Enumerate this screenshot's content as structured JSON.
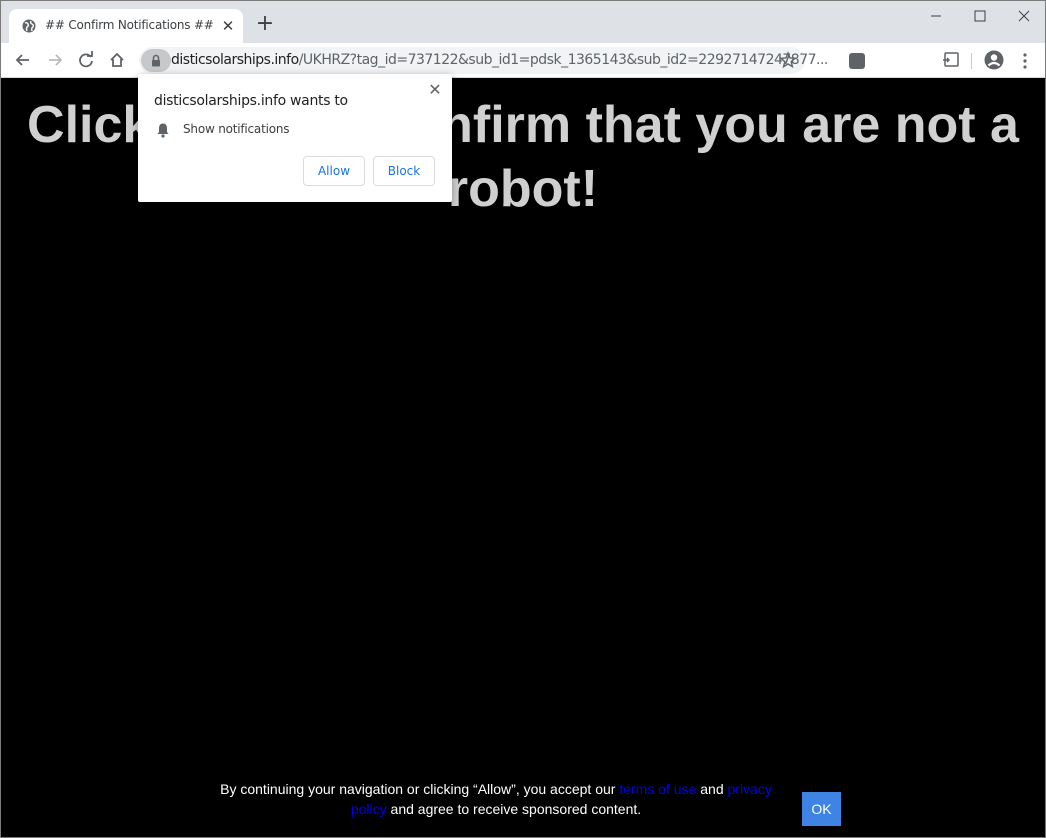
{
  "browser": {
    "tab_title": "## Confirm Notifications ##",
    "tab_close": "✕",
    "new_tab": "+",
    "url_domain": "disticsolarships.info",
    "url_path": "/UKHRZ?tag_id=737122&sub_id1=pdsk_1365143&sub_id2=22927147247877..."
  },
  "page": {
    "headline": "Click Allow to confirm that you are not a robot!",
    "footer": {
      "text_before": "By continuing your navigation or clicking “Allow”, you accept our ",
      "terms_link": "terms of use",
      "text_and": " and ",
      "privacy_link": "privacy policy",
      "text_after": " and agree to receive sponsored content."
    },
    "ok_button": "OK"
  },
  "popup": {
    "title": "disticsolarships.info wants to",
    "close": "✕",
    "permission": "Show notifications",
    "allow_label": "Allow",
    "block_label": "Block"
  },
  "colors": {
    "page_background": "#000000",
    "headline": "#d0d0d0",
    "link": "#0000ee",
    "ok_button": "#3f84e5",
    "popup_button_text": "#1a73e8"
  }
}
